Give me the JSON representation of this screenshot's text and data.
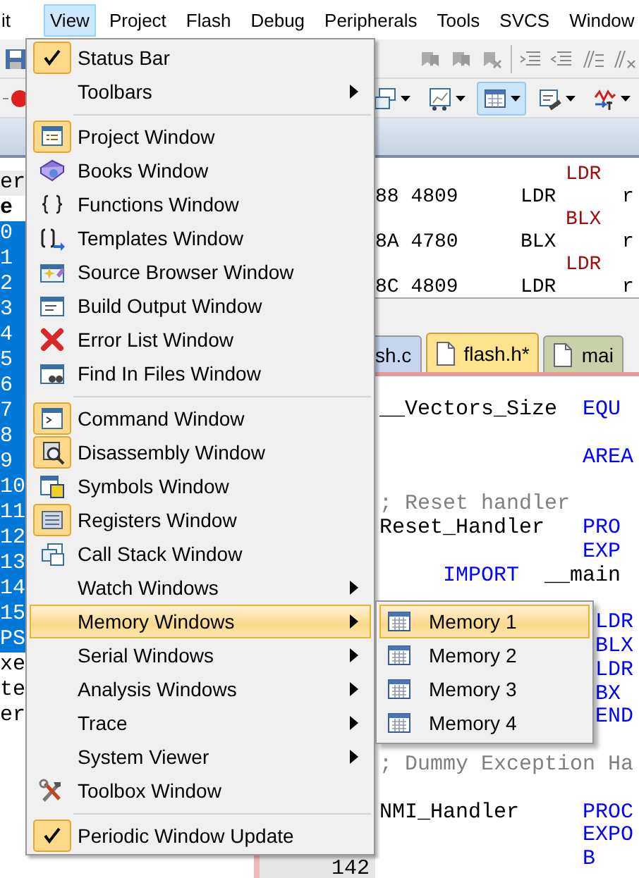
{
  "menu_bar": [
    {
      "label": "it",
      "selected": false
    },
    {
      "label": "View",
      "selected": true
    },
    {
      "label": "Project",
      "selected": false
    },
    {
      "label": "Flash",
      "selected": false
    },
    {
      "label": "Debug",
      "selected": false
    },
    {
      "label": "Peripherals",
      "selected": false
    },
    {
      "label": "Tools",
      "selected": false
    },
    {
      "label": "SVCS",
      "selected": false
    },
    {
      "label": "Window",
      "selected": false
    }
  ],
  "toolbar_2": {
    "buttons": [
      {
        "pressed": false
      },
      {
        "pressed": false
      },
      {
        "pressed": true
      },
      {
        "pressed": false
      },
      {
        "pressed": false
      }
    ]
  },
  "left_panel": {
    "header": "er",
    "column": "e",
    "rows": [
      {
        "text": "0",
        "selected": true
      },
      {
        "text": "1",
        "selected": true
      },
      {
        "text": "2",
        "selected": true
      },
      {
        "text": "3",
        "selected": true
      },
      {
        "text": "4",
        "selected": true
      },
      {
        "text": "5",
        "selected": true
      },
      {
        "text": "6",
        "selected": true
      },
      {
        "text": "7",
        "selected": true
      },
      {
        "text": "8",
        "selected": true
      },
      {
        "text": "9",
        "selected": true
      },
      {
        "text": "10",
        "selected": true
      },
      {
        "text": "11",
        "selected": true
      },
      {
        "text": "12",
        "selected": true
      },
      {
        "text": "13",
        "selected": true
      },
      {
        "text": "14",
        "selected": true
      },
      {
        "text": "15",
        "selected": true
      },
      {
        "text": "PS",
        "selected": true
      },
      {
        "text": "xe",
        "selected": false
      },
      {
        "text": "te",
        "selected": false
      },
      {
        "text": "er",
        "selected": false
      }
    ]
  },
  "disassembly": {
    "lines": [
      {
        "kind": "source",
        "text": "LDR"
      },
      {
        "kind": "code",
        "address": "88 4809",
        "mnemonic": "LDR",
        "operand": "r"
      },
      {
        "kind": "source",
        "text": "BLX"
      },
      {
        "kind": "code",
        "address": "8A 4780",
        "mnemonic": "BLX",
        "operand": "r"
      },
      {
        "kind": "source",
        "text": "LDR"
      },
      {
        "kind": "code",
        "address": "8C 4809",
        "mnemonic": "LDR",
        "operand": "r"
      }
    ]
  },
  "tabs": [
    {
      "label": "sh.c",
      "selected": false,
      "color": "#c6d6f0"
    },
    {
      "label": "flash.h*",
      "selected": true,
      "color": "#fde38b"
    },
    {
      "label": "mai",
      "selected": false,
      "color": "#c9d1a9"
    }
  ],
  "editor": {
    "line_number": "142",
    "lines": [
      {
        "kind": "directive",
        "label": "__Vectors_Size",
        "keyword": "EQU"
      },
      {
        "kind": "blank"
      },
      {
        "kind": "directive",
        "keyword": "AREA"
      },
      {
        "kind": "blank"
      },
      {
        "kind": "comment",
        "text": "; Reset handler"
      },
      {
        "kind": "directive",
        "label": "Reset_Handler",
        "keyword": "PRO"
      },
      {
        "kind": "directive",
        "keyword": "EXP"
      },
      {
        "kind": "instruction",
        "keyword": "IMPORT",
        "argument": "__main"
      },
      {
        "kind": "blank"
      },
      {
        "kind": "operation",
        "keyword": "LDR"
      },
      {
        "kind": "operation",
        "keyword": "BLX"
      },
      {
        "kind": "operation",
        "keyword": "LDR"
      },
      {
        "kind": "operation",
        "keyword": "BX"
      },
      {
        "kind": "operation",
        "keyword": "END"
      },
      {
        "kind": "blank"
      },
      {
        "kind": "comment",
        "text": "; Dummy Exception Ha"
      },
      {
        "kind": "blank"
      },
      {
        "kind": "directive",
        "label": "NMI_Handler",
        "keyword": "PROC"
      },
      {
        "kind": "directive",
        "keyword": "EXPO"
      },
      {
        "kind": "directive",
        "keyword": "B"
      }
    ]
  },
  "view_menu": {
    "groups": [
      [
        {
          "label": "Status Bar",
          "checked": true,
          "selected": false,
          "has_submenu": false
        },
        {
          "label": "Toolbars",
          "checked": false,
          "active": false,
          "selected": false,
          "has_submenu": true
        }
      ],
      [
        {
          "label": "Project Window",
          "checked": false,
          "active": true,
          "selected": false,
          "has_submenu": false
        },
        {
          "label": "Books Window",
          "checked": false,
          "active": false,
          "selected": false,
          "has_submenu": false
        },
        {
          "label": "Functions Window",
          "checked": false,
          "active": false,
          "selected": false,
          "has_submenu": false
        },
        {
          "label": "Templates Window",
          "checked": false,
          "active": false,
          "selected": false,
          "has_submenu": false
        },
        {
          "label": "Source Browser Window",
          "checked": false,
          "active": false,
          "selected": false,
          "has_submenu": false
        },
        {
          "label": "Build Output Window",
          "checked": false,
          "active": false,
          "selected": false,
          "has_submenu": false
        },
        {
          "label": "Error List Window",
          "checked": false,
          "active": false,
          "selected": false,
          "has_submenu": false
        },
        {
          "label": "Find In Files Window",
          "checked": false,
          "active": false,
          "selected": false,
          "has_submenu": false
        }
      ],
      [
        {
          "label": "Command Window",
          "checked": false,
          "active": true,
          "selected": false,
          "has_submenu": false
        },
        {
          "label": "Disassembly Window",
          "checked": false,
          "active": true,
          "selected": false,
          "has_submenu": false
        },
        {
          "label": "Symbols Window",
          "checked": false,
          "active": false,
          "selected": false,
          "has_submenu": false
        },
        {
          "label": "Registers Window",
          "checked": false,
          "active": true,
          "selected": false,
          "has_submenu": false
        },
        {
          "label": "Call Stack Window",
          "checked": false,
          "active": false,
          "selected": false,
          "has_submenu": false
        },
        {
          "label": "Watch Windows",
          "checked": false,
          "active": false,
          "selected": false,
          "has_submenu": true
        },
        {
          "label": "Memory Windows",
          "checked": false,
          "active": false,
          "selected": true,
          "has_submenu": true
        },
        {
          "label": "Serial Windows",
          "checked": false,
          "active": false,
          "selected": false,
          "has_submenu": true
        },
        {
          "label": "Analysis Windows",
          "checked": false,
          "active": false,
          "selected": false,
          "has_submenu": true
        },
        {
          "label": "Trace",
          "checked": false,
          "active": false,
          "selected": false,
          "has_submenu": true
        },
        {
          "label": "System Viewer",
          "checked": false,
          "active": false,
          "selected": false,
          "has_submenu": true
        },
        {
          "label": "Toolbox Window",
          "checked": false,
          "active": false,
          "selected": false,
          "has_submenu": false
        }
      ],
      [
        {
          "label": "Periodic Window Update",
          "checked": true,
          "selected": false,
          "has_submenu": false
        }
      ]
    ]
  },
  "memory_submenu": {
    "items": [
      {
        "label": "Memory 1",
        "selected": true
      },
      {
        "label": "Memory 2",
        "selected": false
      },
      {
        "label": "Memory 3",
        "selected": false
      },
      {
        "label": "Memory 4",
        "selected": false
      }
    ]
  }
}
